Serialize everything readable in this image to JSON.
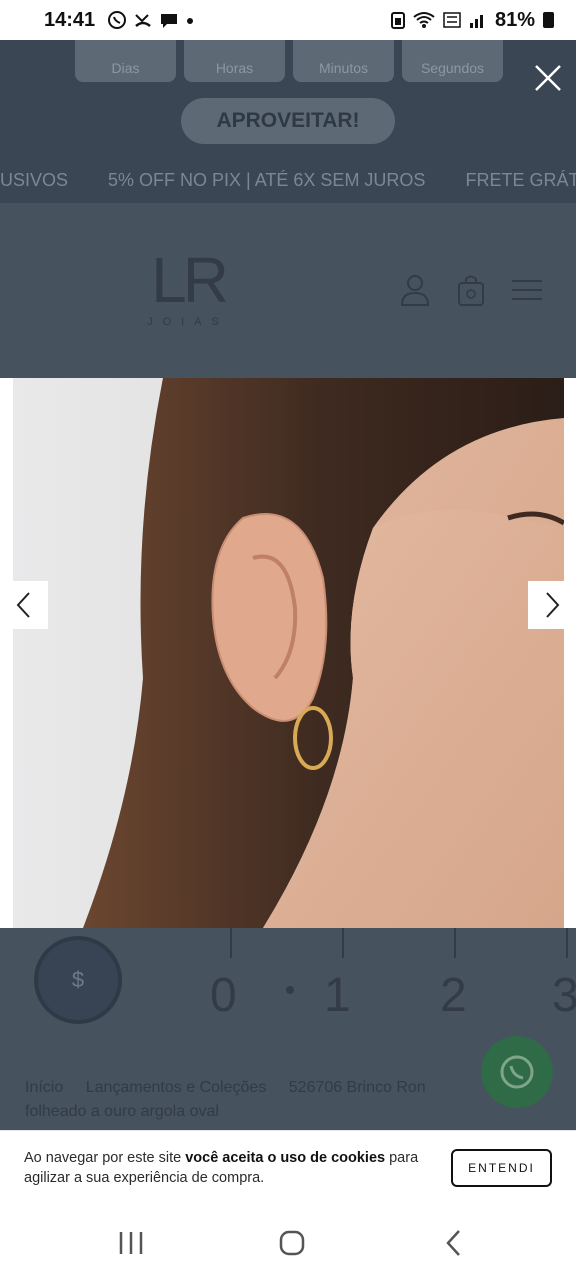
{
  "status_bar": {
    "time": "14:41",
    "battery": "81%",
    "left_icons": [
      "whatsapp-icon",
      "missed-call-icon",
      "chat-icon",
      "dot-icon"
    ],
    "right_icons": [
      "battery-saver-icon",
      "wifi-icon",
      "volte-icon",
      "signal-icon",
      "battery-icon"
    ]
  },
  "promo": {
    "countdown_labels": [
      "Dias",
      "Horas",
      "Minutos",
      "Segundos"
    ],
    "cta_label": "APROVEITAR!",
    "ticker_items": [
      "USIVOS",
      "5% OFF NO PIX | ATÉ 6X SEM JUROS",
      "FRETE GRÁT"
    ]
  },
  "header": {
    "logo_mark": "LR",
    "logo_sub": "JOIAS"
  },
  "under_content": {
    "scale_numbers": [
      "0",
      "1",
      "2",
      "3"
    ],
    "coupon_symbol": "$",
    "breadcrumb": [
      "Início",
      "Lançamentos e Coleções",
      "526706 Brinco Ron"
    ],
    "breadcrumb_line2": "folheado a ouro argola oval"
  },
  "cookie_banner": {
    "text_start": "Ao navegar por este site ",
    "text_bold": "você aceita o uso de cookies",
    "text_end": " para agilizar a sua experiência de compra.",
    "button_label": "ENTENDI"
  },
  "colors": {
    "overlay": "#47525f",
    "accent_whatsapp": "#2f6b47"
  }
}
